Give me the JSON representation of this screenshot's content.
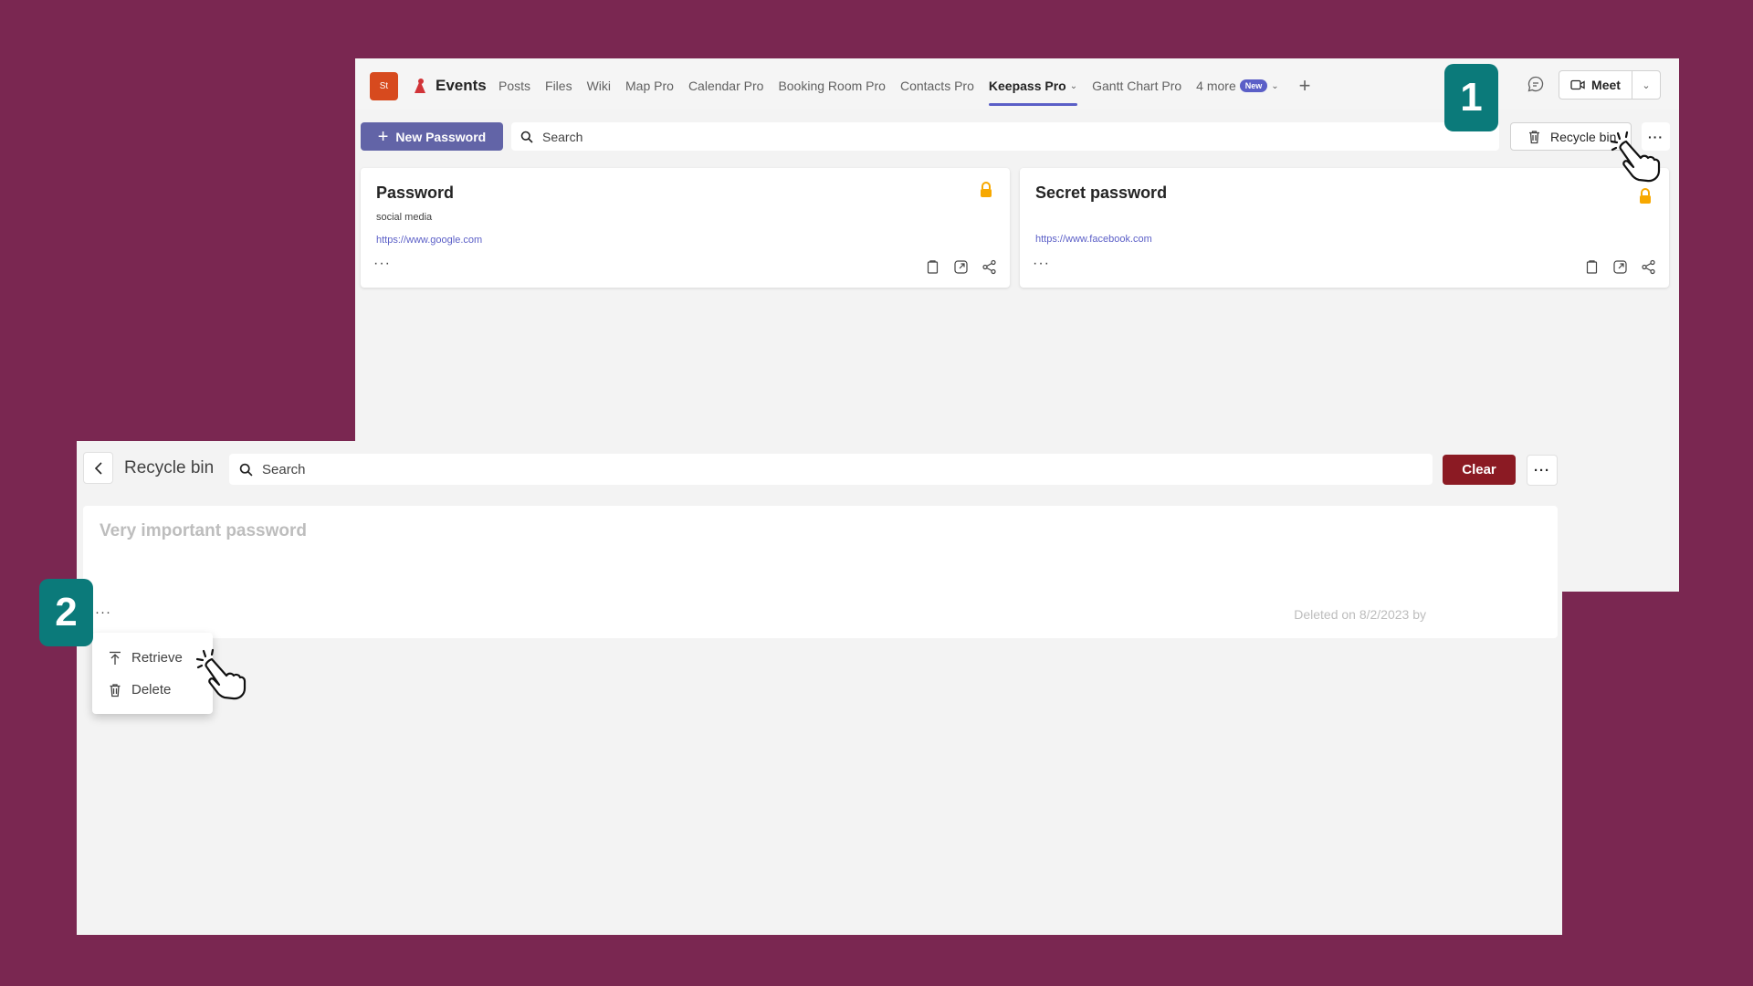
{
  "colors": {
    "background": "#7a2751",
    "accent": "#6264a7",
    "danger": "#8b1a23",
    "step_badge": "#0b7a7a",
    "link": "#5b5fc7"
  },
  "team": {
    "avatar_text": "St",
    "channel_name": "Events"
  },
  "tabs": [
    {
      "label": "Posts"
    },
    {
      "label": "Files"
    },
    {
      "label": "Wiki"
    },
    {
      "label": "Map Pro"
    },
    {
      "label": "Calendar Pro"
    },
    {
      "label": "Booking Room Pro"
    },
    {
      "label": "Contacts Pro"
    },
    {
      "label": "Keepass Pro",
      "active": true
    },
    {
      "label": "Gantt Chart Pro"
    },
    {
      "label": "4 more",
      "badge": "New"
    }
  ],
  "header": {
    "meet_label": "Meet"
  },
  "toolbar": {
    "new_password_label": "New Password",
    "search_placeholder": "Search",
    "recycle_bin_label": "Recycle bin",
    "more_label": "···"
  },
  "passwords": [
    {
      "title": "Password",
      "description": "social media",
      "url": "https://www.google.com"
    },
    {
      "title": "Secret password",
      "description": "",
      "url": "https://www.facebook.com"
    }
  ],
  "card_more_label": "···",
  "recycle_bin": {
    "title": "Recycle bin",
    "search_placeholder": "Search",
    "clear_label": "Clear",
    "more_label": "···",
    "item": {
      "title": "Very important password",
      "more_label": "···",
      "deleted_info": "Deleted on 8/2/2023 by"
    },
    "menu": {
      "retrieve_label": "Retrieve",
      "delete_label": "Delete"
    }
  },
  "steps": {
    "step1": "1",
    "step2": "2"
  },
  "icons": [
    "search-icon",
    "plus-icon",
    "trash-icon",
    "chat-icon",
    "video-icon",
    "chevron-down-icon",
    "lock-icon",
    "copy-icon",
    "open-icon",
    "share-icon",
    "back-icon",
    "retrieve-icon",
    "hand-cursor-icon"
  ]
}
